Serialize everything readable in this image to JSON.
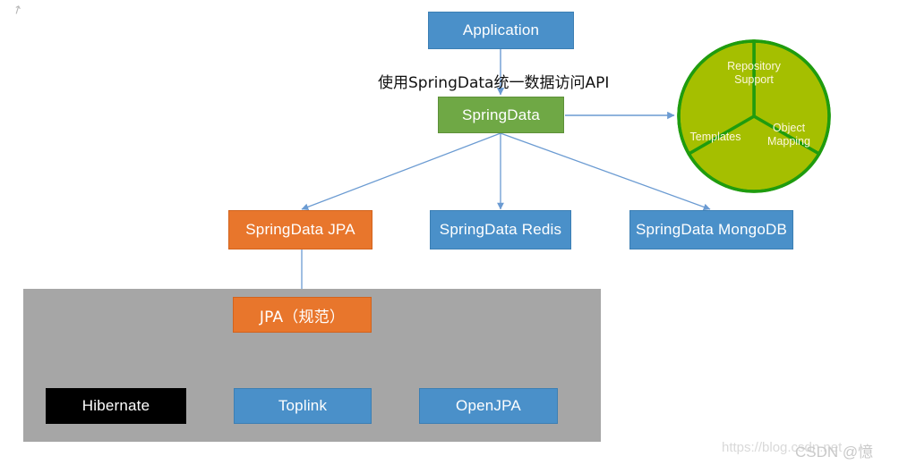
{
  "diagram": {
    "title_annotation": "使用SpringData统一数据访问API",
    "nodes": {
      "application": {
        "label": "Application",
        "color": "#4a90c9"
      },
      "springdata": {
        "label": "SpringData",
        "color": "#6fa845"
      },
      "springdata_jpa": {
        "label": "SpringData JPA",
        "color": "#e8762c"
      },
      "springdata_redis": {
        "label": "SpringData Redis",
        "color": "#4a90c9"
      },
      "springdata_mongodb": {
        "label": "SpringData MongoDB",
        "color": "#4a90c9"
      },
      "jpa_spec": {
        "label": "JPA（规范）",
        "color": "#e8762c"
      },
      "hibernate": {
        "label": "Hibernate",
        "color": "#000000"
      },
      "toplink": {
        "label": "Toplink",
        "color": "#4a90c9"
      },
      "openjpa": {
        "label": "OpenJPA",
        "color": "#4a90c9"
      }
    },
    "panel": {
      "color": "#a6a6a6"
    },
    "pie": {
      "fill": "#a5bf00",
      "stroke": "#1f9c0e",
      "slices": [
        {
          "label": "Repository\nSupport"
        },
        {
          "label": "Object\nMapping"
        },
        {
          "label": "Templates"
        }
      ]
    },
    "arrow_color": "#6b9bd2"
  },
  "watermark": {
    "url": "https://blog.csdn.net",
    "brand": "CSDN @憶",
    "corner": "↗"
  }
}
